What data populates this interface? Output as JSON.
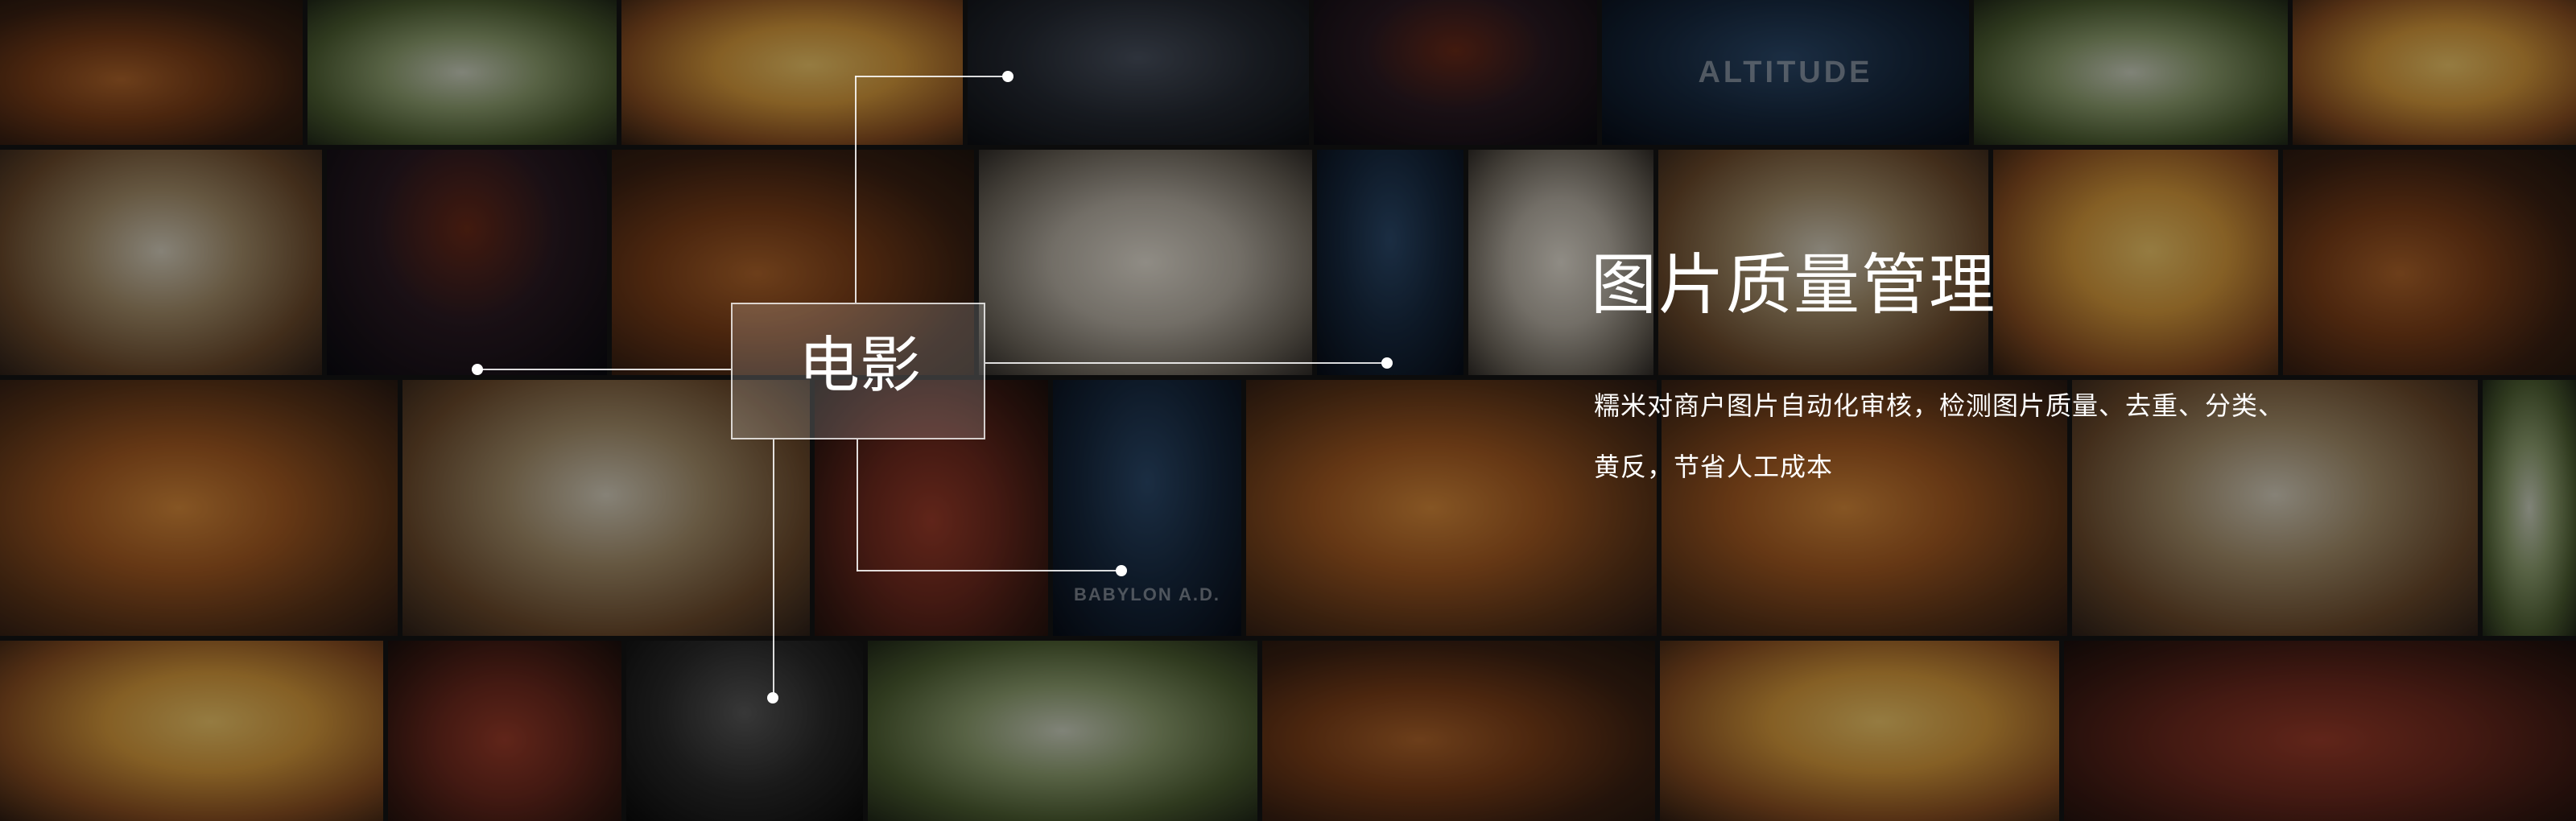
{
  "category": {
    "label": "电影"
  },
  "feature": {
    "title": "图片质量管理",
    "description": "糯米对商户图片自动化审核，检测图片质量、去重、分类、黄反，节省人工成本"
  },
  "poster_texts": {
    "altitude": "ALTITUDE",
    "babylon": "BABYLON A.D."
  }
}
